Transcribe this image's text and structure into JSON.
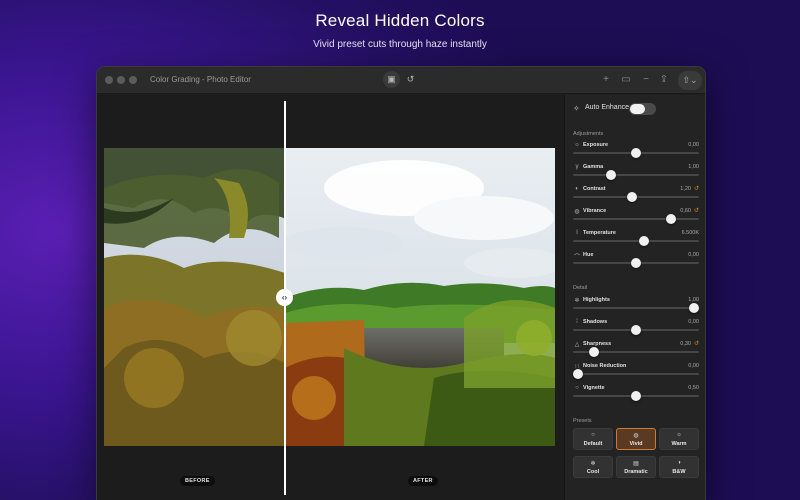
{
  "hero": {
    "title": "Reveal Hidden Colors",
    "subtitle": "Vivid preset cuts through haze instantly"
  },
  "window": {
    "title": "Color Grading - Photo Editor",
    "toolbar_icons": [
      "compare-icon",
      "history-icon",
      "add-icon",
      "folder-icon",
      "minus-icon",
      "export-icon",
      "share-icon"
    ]
  },
  "canvas": {
    "before_label": "BEFORE",
    "after_label": "AFTER",
    "split_handle_glyph": "‹›"
  },
  "panel": {
    "auto_enhance": {
      "label": "Auto Enhance",
      "enabled": false
    },
    "adjustments_title": "Adjustments",
    "adjustments": [
      {
        "name": "exposure",
        "label": "Exposure",
        "value": "0,00",
        "level": 0.5,
        "icon": "sun-icon",
        "modified": false
      },
      {
        "name": "gamma",
        "label": "Gamma",
        "value": "1,00",
        "level": 0.3,
        "icon": "gamma-icon",
        "modified": false
      },
      {
        "name": "contrast",
        "label": "Contrast",
        "value": "1,20",
        "level": 0.47,
        "icon": "contrast-icon",
        "modified": true
      },
      {
        "name": "vibrance",
        "label": "Vibrance",
        "value": "0,60",
        "level": 0.78,
        "icon": "palette-icon",
        "modified": true
      },
      {
        "name": "temperature",
        "label": "Temperature",
        "value": "6.500K",
        "level": 0.56,
        "icon": "thermometer-icon",
        "modified": false
      },
      {
        "name": "hue",
        "label": "Hue",
        "value": "0,00",
        "level": 0.5,
        "icon": "rainbow-icon",
        "modified": false
      }
    ],
    "detail_title": "Detail",
    "detail": [
      {
        "name": "highlights",
        "label": "Highlights",
        "value": "1,00",
        "level": 0.96,
        "icon": "highlights-icon",
        "modified": false
      },
      {
        "name": "shadows",
        "label": "Shadows",
        "value": "0,00",
        "level": 0.5,
        "icon": "shadows-icon",
        "modified": false
      },
      {
        "name": "sharpness",
        "label": "Sharpness",
        "value": "0,30",
        "level": 0.17,
        "icon": "triangle-icon",
        "modified": true
      },
      {
        "name": "noise-reduction",
        "label": "Noise Reduction",
        "value": "0,00",
        "level": 0.04,
        "icon": "noise-icon",
        "modified": false
      },
      {
        "name": "vignette",
        "label": "Vignette",
        "value": "0,50",
        "level": 0.5,
        "icon": "circle-icon",
        "modified": false
      }
    ],
    "presets_title": "Presets",
    "presets": [
      {
        "name": "default",
        "label": "Default",
        "icon": "circle-icon",
        "selected": false
      },
      {
        "name": "vivid",
        "label": "Vivid",
        "icon": "palette-icon",
        "selected": true
      },
      {
        "name": "warm",
        "label": "Warm",
        "icon": "sun-icon",
        "selected": false
      },
      {
        "name": "cool",
        "label": "Cool",
        "icon": "snowflake-icon",
        "selected": false
      },
      {
        "name": "dramatic",
        "label": "Dramatic",
        "icon": "photo-stack-icon",
        "selected": false
      },
      {
        "name": "bw",
        "label": "B&W",
        "icon": "half-circle-icon",
        "selected": false
      }
    ]
  },
  "colors": {
    "accent": "#d07a34",
    "background": "#2a1475",
    "panel": "#232323"
  }
}
